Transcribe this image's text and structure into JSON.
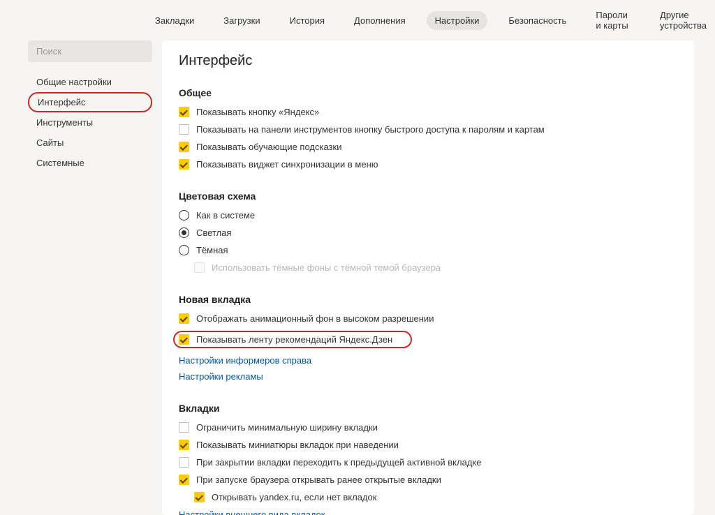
{
  "topTabs": {
    "t0": "Закладки",
    "t1": "Загрузки",
    "t2": "История",
    "t3": "Дополнения",
    "t4": "Настройки",
    "t5": "Безопасность",
    "t6": "Пароли и карты",
    "t7": "Другие устройства"
  },
  "sidebar": {
    "search_placeholder": "Поиск",
    "s0": "Общие настройки",
    "s1": "Интерфейс",
    "s2": "Инструменты",
    "s3": "Сайты",
    "s4": "Системные"
  },
  "page": {
    "title": "Интерфейс"
  },
  "general": {
    "title": "Общее",
    "c0": "Показывать кнопку «Яндекс»",
    "c1": "Показывать на панели инструментов кнопку быстрого доступа к паролям и картам",
    "c2": "Показывать обучающие подсказки",
    "c3": "Показывать виджет синхронизации в меню"
  },
  "color": {
    "title": "Цветовая схема",
    "r0": "Как в системе",
    "r1": "Светлая",
    "r2": "Тёмная",
    "sub": "Использовать тёмные фоны с тёмной темой браузера"
  },
  "newtab": {
    "title": "Новая вкладка",
    "c0": "Отображать анимационный фон в высоком разрешении",
    "c1": "Показывать ленту рекомендаций Яндекс.Дзен",
    "link0": "Настройки информеров справа",
    "link1": "Настройки рекламы"
  },
  "tabs": {
    "title": "Вкладки",
    "c0": "Ограничить минимальную ширину вкладки",
    "c1": "Показывать миниатюры вкладок при наведении",
    "c2": "При закрытии вкладки переходить к предыдущей активной вкладке",
    "c3": "При запуске браузера открывать ранее открытые вкладки",
    "c3sub": "Открывать yandex.ru, если нет вкладок",
    "link0": "Настройки внешнего вида вкладок"
  }
}
